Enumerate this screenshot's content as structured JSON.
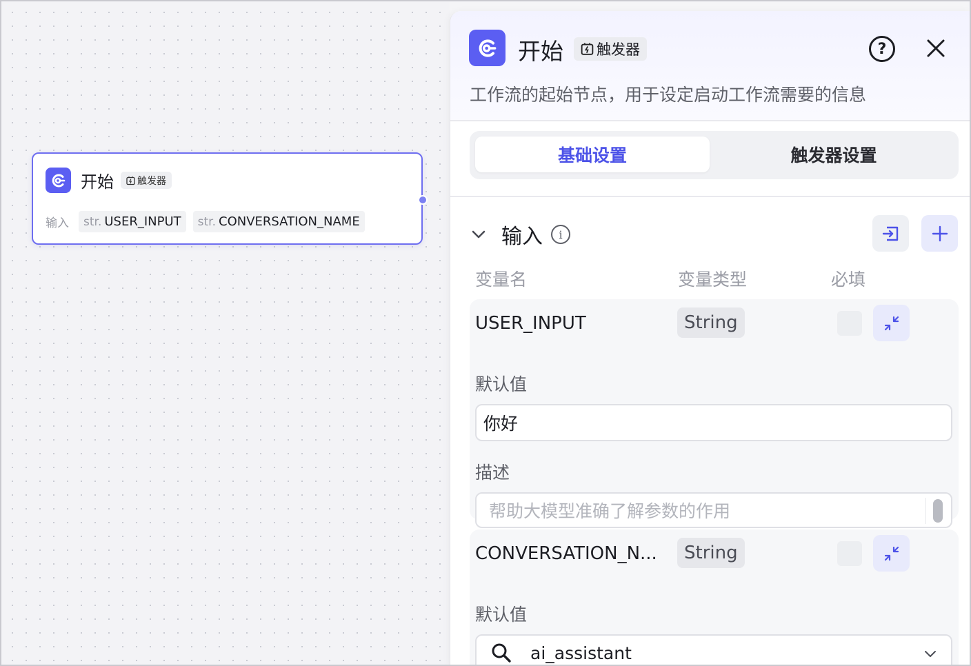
{
  "canvas": {
    "node": {
      "title": "开始",
      "tag": "触发器",
      "inputs_label": "输入",
      "inputs": [
        {
          "type": "str.",
          "name": "USER_INPUT"
        },
        {
          "type": "str.",
          "name": "CONVERSATION_NAME"
        }
      ]
    }
  },
  "panel": {
    "title": "开始",
    "tag": "触发器",
    "help_label": "?",
    "description": "工作流的起始节点，用于设定启动工作流需要的信息",
    "tabs": [
      {
        "label": "基础设置",
        "active": true
      },
      {
        "label": "触发器设置",
        "active": false
      }
    ],
    "section": {
      "title": "输入",
      "info_label": "i",
      "columns": [
        "变量名",
        "变量类型",
        "必填"
      ],
      "variables": [
        {
          "name": "USER_INPUT",
          "type": "String",
          "default_label": "默认值",
          "default_value": "你好",
          "desc_label": "描述",
          "desc_placeholder": "帮助大模型准确了解参数的作用"
        },
        {
          "name": "CONVERSATION_N...",
          "type": "String",
          "default_label": "默认值",
          "default_value": "ai_assistant"
        }
      ]
    }
  },
  "colors": {
    "accent": "#5b5ef2",
    "accent_text": "#4d53e8",
    "node_border": "#6e6ef0"
  }
}
